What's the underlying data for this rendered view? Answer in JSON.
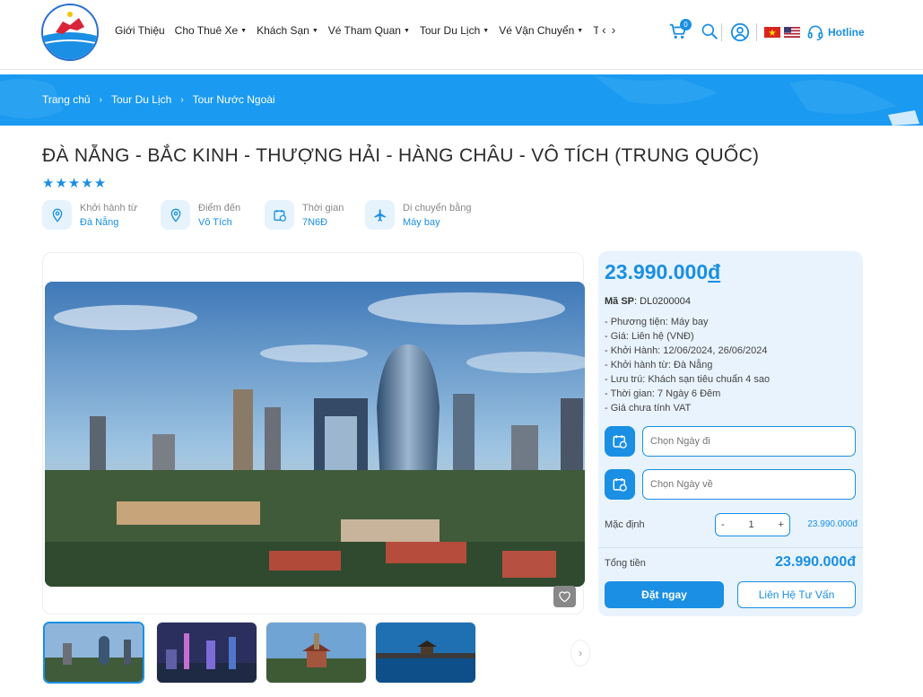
{
  "nav": {
    "items": [
      {
        "label": "Giới Thiệu",
        "caret": false
      },
      {
        "label": "Cho Thuê Xe",
        "caret": true
      },
      {
        "label": "Khách Sạn",
        "caret": true
      },
      {
        "label": "Vé Tham Quan",
        "caret": true
      },
      {
        "label": "Tour Du Lịch",
        "caret": true
      },
      {
        "label": "Vé Vận Chuyển",
        "caret": true
      },
      {
        "label": "T",
        "caret": false
      }
    ],
    "prev_arrow": "‹",
    "next_arrow": "›"
  },
  "header": {
    "cart_count": "0",
    "hotline": "Hotline",
    "icons": [
      "cart-icon",
      "search-icon",
      "user-icon",
      "vietnam-flag-icon",
      "us-flag-icon",
      "headset-icon"
    ]
  },
  "breadcrumb": [
    "Trang chủ",
    "Tour Du Lịch",
    "Tour Nước Ngoài"
  ],
  "tour": {
    "title": "ĐÀ NẴNG - BẮC KINH - THƯỢNG HẢI - HÀNG CHÂU - VÔ TÍCH (TRUNG QUỐC)",
    "rating": 5,
    "stars": "★★★★★",
    "info": [
      {
        "label": "Khởi hành từ",
        "value": "Đà Nẵng",
        "icon": "location-pin-icon"
      },
      {
        "label": "Điểm đến",
        "value": "Vô Tích",
        "icon": "location-pin-icon"
      },
      {
        "label": "Thời gian",
        "value": "7N6Đ",
        "icon": "calendar-clock-icon"
      },
      {
        "label": "Di chuyển bằng",
        "value": "Máy bay",
        "icon": "airplane-icon"
      }
    ]
  },
  "gallery": {
    "thumbs": [
      "beijing-skyline",
      "shanghai-night",
      "temple",
      "lake-pavilion"
    ],
    "next": "›"
  },
  "booking": {
    "price": "23.990.000",
    "currency": "đ",
    "sku_label": "Mã SP",
    "sku_value": ": DL0200004",
    "specs": [
      "- Phương tiện: Máy bay",
      "- Giá: Liên hệ (VNĐ)",
      "- Khởi Hành: 12/06/2024, 26/06/2024",
      "- Khởi hành từ: Đà Nẵng",
      "- Lưu trú: Khách sạn tiêu chuẩn 4 sao",
      "- Thời gian: 7 Ngày 6 Đêm",
      "- Giá chưa tính VAT"
    ],
    "depart_placeholder": "Chọn Ngày đi",
    "return_placeholder": "Chọn Ngày về",
    "qty_label": "Mặc định",
    "qty_minus": "-",
    "qty_value": "1",
    "qty_plus": "+",
    "qty_price": "23.990.000đ",
    "total_label": "Tổng tiền",
    "total_value": "23.990.000đ",
    "book_label": "Đặt ngay",
    "contact_label": "Liên Hệ Tư Vấn"
  }
}
